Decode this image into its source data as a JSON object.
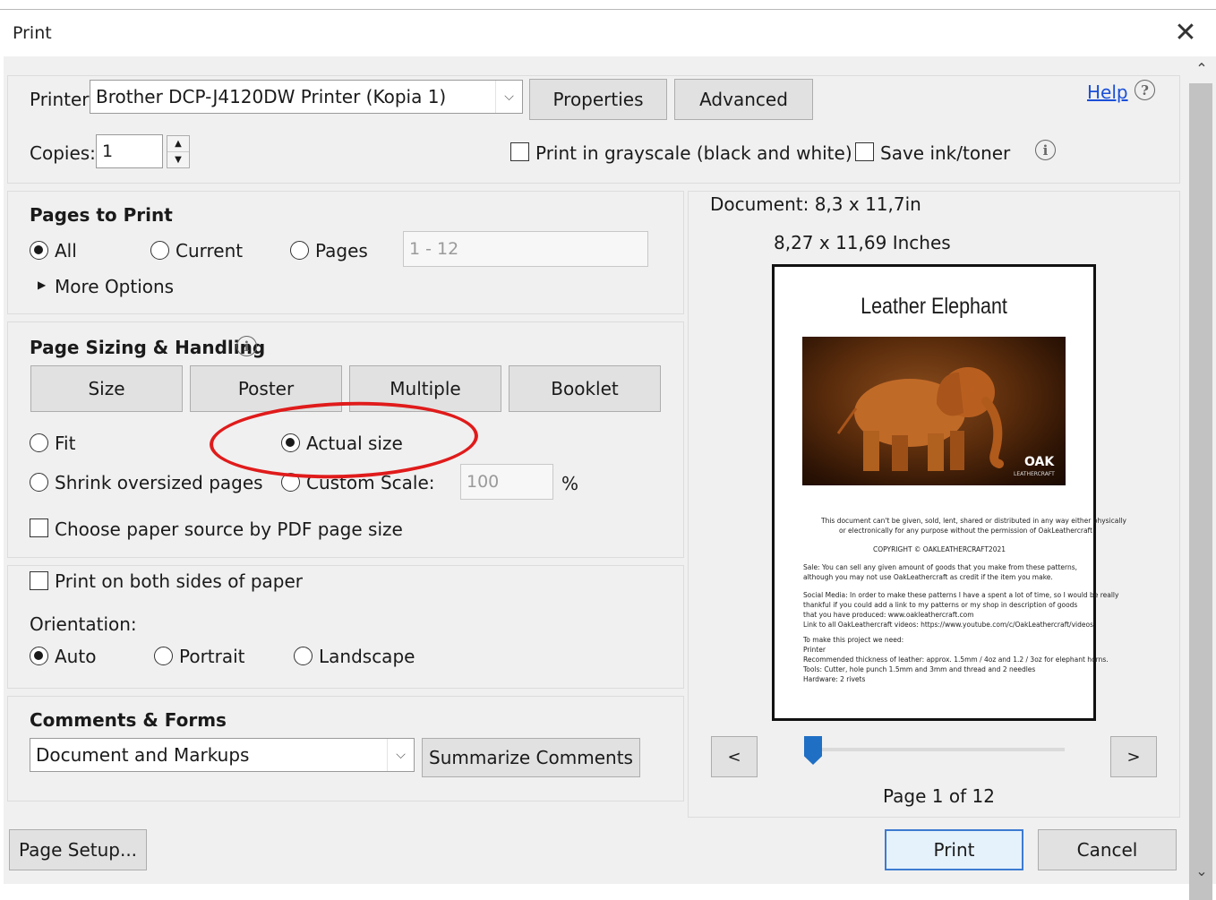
{
  "window": {
    "title": "Print",
    "close_symbol": "✕"
  },
  "printer": {
    "label": "Printer:",
    "selected": "Brother DCP-J4120DW Printer (Kopia 1)",
    "properties_button": "Properties",
    "advanced_button": "Advanced",
    "help_link": "Help",
    "help_icon": "?"
  },
  "copies": {
    "label": "Copies:",
    "value": "1",
    "grayscale_label": "Print in grayscale (black and white)",
    "grayscale_checked": false,
    "save_ink_label": "Save ink/toner",
    "save_ink_checked": false
  },
  "pages_to_print": {
    "heading": "Pages to Print",
    "options": [
      "All",
      "Current",
      "Pages"
    ],
    "selected": "All",
    "pages_range_placeholder": "1 - 12",
    "more_options": "More Options"
  },
  "page_sizing": {
    "heading": "Page Sizing & Handling",
    "tabs": [
      "Size",
      "Poster",
      "Multiple",
      "Booklet"
    ],
    "fit_label": "Fit",
    "actual_size_label": "Actual size",
    "shrink_label": "Shrink oversized pages",
    "custom_scale_label": "Custom Scale:",
    "custom_scale_value": "100",
    "percent_sign": "%",
    "selected": "Actual size",
    "paper_source_label": "Choose paper source by PDF page size",
    "paper_source_checked": false
  },
  "duplex": {
    "label": "Print on both sides of paper",
    "checked": false
  },
  "orientation": {
    "label": "Orientation:",
    "options": [
      "Auto",
      "Portrait",
      "Landscape"
    ],
    "selected": "Auto"
  },
  "comments_forms": {
    "heading": "Comments & Forms",
    "selected": "Document and Markups",
    "summarize_button": "Summarize Comments"
  },
  "preview": {
    "document_size": "Document: 8,3 x 11,7in",
    "paper_size": "8,27 x 11,69 Inches",
    "doc_title": "Leather Elephant",
    "logo_text": "OAK",
    "logo_sub": "LEATHERCRAFT",
    "body_lines": [
      "This document can't be given, sold, lent, shared or distributed in any way either physically",
      "or electronically for any purpose without the permission of OakLeathercraft",
      "COPYRIGHT © OAKLEATHERCRAFT2021",
      "Sale: You can sell any given amount of goods that you make from these patterns,",
      "although you may not use OakLeathercraft as credit if the item you make.",
      "Social Media: In order to make these patterns I have a spent a lot of time, so I would be really",
      "thankful if you could add a link to my patterns or my shop in description of goods",
      "that you have produced: www.oakleathercraft.com",
      "Link to all OakLeathercraft videos:   https://www.youtube.com/c/OakLeathercraft/videos",
      "To make this project we need:",
      "Printer",
      "Recommended thickness of leather: approx. 1.5mm / 4oz and 1.2 / 3oz for elephant horns.",
      "Tools: Cutter, hole punch 1.5mm and 3mm and thread and 2 needles",
      "Hardware: 2 rivets"
    ],
    "prev_button": "<",
    "next_button": ">",
    "page_indicator": "Page 1 of 12",
    "slider_position_fraction": 0.0
  },
  "footer": {
    "page_setup_button": "Page Setup...",
    "print_button": "Print",
    "cancel_button": "Cancel"
  },
  "annotation": {
    "color": "#e01b1b"
  },
  "scrollbar": {
    "up": "⌃",
    "down": "⌄"
  }
}
